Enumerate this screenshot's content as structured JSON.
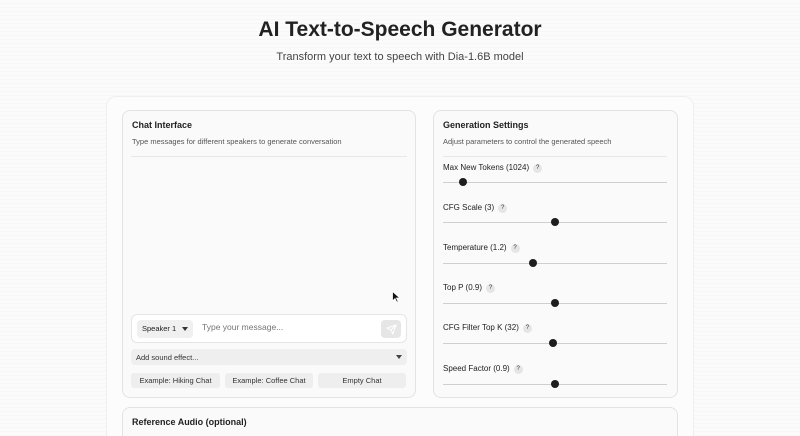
{
  "header": {
    "title": "AI Text-to-Speech Generator",
    "subtitle": "Transform your text to speech with Dia-1.6B model"
  },
  "chat": {
    "title": "Chat Interface",
    "description": "Type messages for different speakers to generate conversation",
    "speaker_value": "Speaker 1",
    "message_placeholder": "Type your message...",
    "sound_effect_placeholder": "Add sound effect...",
    "examples": [
      "Example: Hiking Chat",
      "Example: Coffee Chat",
      "Empty Chat"
    ]
  },
  "settings": {
    "title": "Generation Settings",
    "description": "Adjust parameters to control the generated speech",
    "help_glyph": "?",
    "sliders": [
      {
        "label": "Max New Tokens (1024)",
        "fraction": 0.09
      },
      {
        "label": "CFG Scale (3)",
        "fraction": 0.5
      },
      {
        "label": "Temperature (1.2)",
        "fraction": 0.4
      },
      {
        "label": "Top P (0.9)",
        "fraction": 0.5
      },
      {
        "label": "CFG Filter Top K (32)",
        "fraction": 0.49
      },
      {
        "label": "Speed Factor (0.9)",
        "fraction": 0.5
      }
    ]
  },
  "reference": {
    "title": "Reference Audio (optional)"
  },
  "colors": {
    "accent": "#1e1e1e",
    "panel_border": "#e3e3e3"
  },
  "icons": {
    "send": "send-icon",
    "cursor": "mouse-pointer-icon"
  }
}
